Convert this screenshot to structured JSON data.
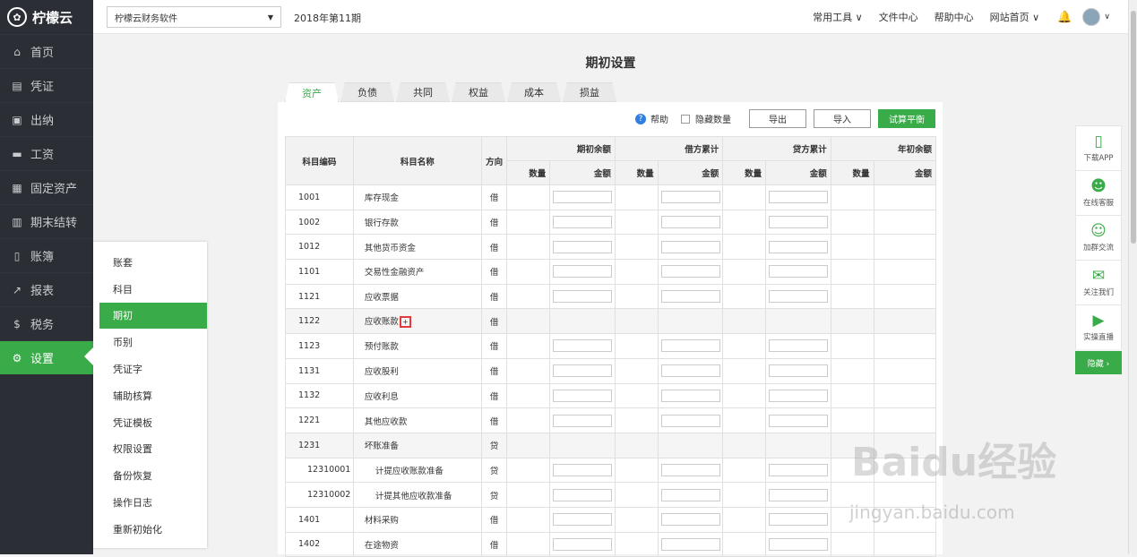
{
  "app": {
    "logo_text": "柠檬云"
  },
  "sidebar": {
    "items": [
      {
        "label": "首页",
        "icon": "home-icon",
        "glyph": "⌂"
      },
      {
        "label": "凭证",
        "icon": "voucher-icon",
        "glyph": "▤"
      },
      {
        "label": "出纳",
        "icon": "cashier-icon",
        "glyph": "▣"
      },
      {
        "label": "工资",
        "icon": "salary-icon",
        "glyph": "▬"
      },
      {
        "label": "固定资产",
        "icon": "asset-icon",
        "glyph": "▦"
      },
      {
        "label": "期末结转",
        "icon": "calendar-icon",
        "glyph": "▥"
      },
      {
        "label": "账簿",
        "icon": "book-icon",
        "glyph": "▯"
      },
      {
        "label": "报表",
        "icon": "chart-icon",
        "glyph": "↗"
      },
      {
        "label": "税务",
        "icon": "tax-icon",
        "glyph": "$"
      },
      {
        "label": "设置",
        "icon": "gear-icon",
        "glyph": "⚙"
      }
    ]
  },
  "submenu": {
    "items": [
      "账套",
      "科目",
      "期初",
      "币别",
      "凭证字",
      "辅助核算",
      "凭证模板",
      "权限设置",
      "备份恢复",
      "操作日志",
      "重新初始化"
    ],
    "active": "期初"
  },
  "topbar": {
    "company": "柠檬云财务软件",
    "period": "2018年第11期",
    "nav": [
      "常用工具 ∨",
      "文件中心",
      "帮助中心",
      "网站首页 ∨"
    ]
  },
  "page": {
    "title": "期初设置"
  },
  "tabs": [
    "资产",
    "负债",
    "共同",
    "权益",
    "成本",
    "损益"
  ],
  "toolbar": {
    "help": "帮助",
    "hide_qty": "隐藏数量",
    "export": "导出",
    "import": "导入",
    "balance": "试算平衡"
  },
  "table": {
    "headers": {
      "code": "科目编码",
      "name": "科目名称",
      "dir": "方向",
      "g1": "期初余额",
      "g2": "借方累计",
      "g3": "贷方累计",
      "g4": "年初余额",
      "qty": "数量",
      "amt": "金额"
    },
    "rows": [
      {
        "code": "1001",
        "name": "库存现金",
        "dir": "借"
      },
      {
        "code": "1002",
        "name": "银行存款",
        "dir": "借"
      },
      {
        "code": "1012",
        "name": "其他货币资金",
        "dir": "借"
      },
      {
        "code": "1101",
        "name": "交易性金融资产",
        "dir": "借"
      },
      {
        "code": "1121",
        "name": "应收票据",
        "dir": "借"
      },
      {
        "code": "1122",
        "name": "应收账款",
        "dir": "借"
      },
      {
        "code": "1123",
        "name": "预付账款",
        "dir": "借"
      },
      {
        "code": "1131",
        "name": "应收股利",
        "dir": "借"
      },
      {
        "code": "1132",
        "name": "应收利息",
        "dir": "借"
      },
      {
        "code": "1221",
        "name": "其他应收款",
        "dir": "借"
      },
      {
        "code": "1231",
        "name": "坏账准备",
        "dir": "贷"
      },
      {
        "code": "12310001",
        "name": "计提应收账款准备",
        "dir": "贷"
      },
      {
        "code": "12310002",
        "name": "计提其他应收款准备",
        "dir": "贷"
      },
      {
        "code": "1401",
        "name": "材料采购",
        "dir": "借"
      },
      {
        "code": "1402",
        "name": "在途物资",
        "dir": "借"
      }
    ],
    "add_symbol": "+"
  },
  "rightbar": {
    "items": [
      "下载APP",
      "在线客服",
      "加群交流",
      "关注我们",
      "实操直播"
    ],
    "hide": "隐藏 ›"
  },
  "watermark": {
    "line1": "Baidu经验",
    "line2": "jingyan.baidu.com"
  }
}
